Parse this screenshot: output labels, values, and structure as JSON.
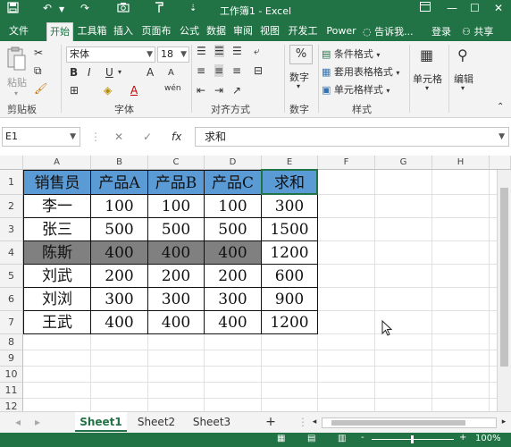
{
  "window": {
    "title": "工作簿1 - Excel",
    "icons": [
      "save-icon",
      "undo-icon",
      "redo-icon",
      "camera-icon",
      "brush-icon",
      "qat-more-icon",
      "ribbon-display-icon",
      "minimize-icon",
      "maximize-icon",
      "close-icon"
    ]
  },
  "tabs": {
    "items": [
      "文件",
      "开始",
      "工具箱",
      "插入",
      "页面布",
      "公式",
      "数据",
      "审阅",
      "视图",
      "开发工",
      "Power"
    ],
    "active": "开始",
    "search": "告诉我...",
    "login": "登录",
    "share": "共享"
  },
  "ribbon": {
    "clipboard": {
      "paste": "粘贴",
      "label": "剪贴板"
    },
    "font": {
      "name": "宋体",
      "size": "18",
      "bold": "B",
      "italic": "I",
      "underline": "U",
      "color_a": "A",
      "grow": "A",
      "shrink": "A",
      "wen": "wén",
      "label": "字体"
    },
    "align": {
      "label": "对齐方式"
    },
    "number": {
      "percent": "%",
      "label": "数字"
    },
    "styles": {
      "conditional": "条件格式",
      "table": "套用表格格式",
      "cell_style": "单元格样式",
      "label": "样式"
    },
    "cells": {
      "label": "单元格"
    },
    "edit": {
      "label": "编辑"
    }
  },
  "formula_bar": {
    "name_box": "E1",
    "cancel": "✕",
    "enter": "✓",
    "fx": "fx",
    "content": "求和"
  },
  "sheet": {
    "columns": [
      "A",
      "B",
      "C",
      "D",
      "E",
      "F",
      "G",
      "H"
    ],
    "rows": [
      "1",
      "2",
      "3",
      "4",
      "5",
      "6",
      "7",
      "8",
      "9",
      "10",
      "11",
      "12"
    ],
    "table": [
      [
        "销售员",
        "产品A",
        "产品B",
        "产品C",
        "求和"
      ],
      [
        "李一",
        "100",
        "100",
        "100",
        "300"
      ],
      [
        "张三",
        "500",
        "500",
        "500",
        "1500"
      ],
      [
        "陈斯",
        "400",
        "400",
        "400",
        "1200"
      ],
      [
        "刘武",
        "200",
        "200",
        "200",
        "600"
      ],
      [
        "刘浏",
        "300",
        "300",
        "300",
        "900"
      ],
      [
        "王武",
        "400",
        "400",
        "400",
        "1200"
      ]
    ],
    "header_color": "#5b9bd5",
    "highlight_color": "#808080"
  },
  "sheet_tabs": {
    "items": [
      "Sheet1",
      "Sheet2",
      "Sheet3"
    ],
    "active": "Sheet1",
    "add": "+"
  },
  "status_bar": {
    "zoom": "100%",
    "minus": "-",
    "plus": "+"
  },
  "colors": {
    "brand": "#217346",
    "ribbon_bg": "#f3f3f3"
  }
}
